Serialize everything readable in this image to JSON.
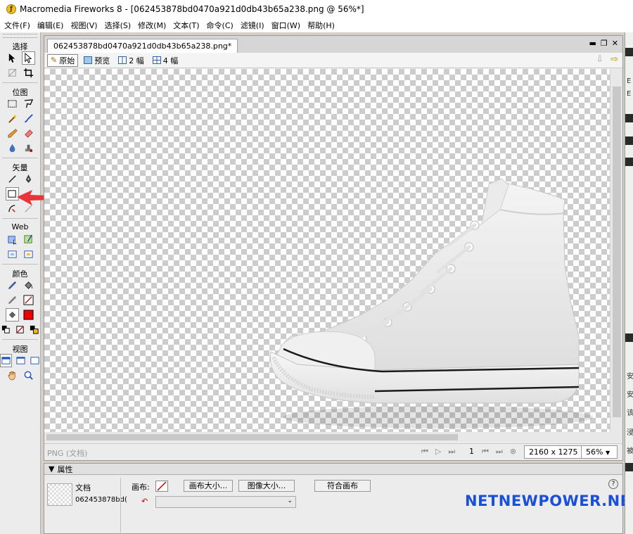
{
  "window": {
    "title": "Macromedia Fireworks 8 - [062453878bd0470a921d0db43b65a238.png @  56%*]",
    "app_icon_letter": "ƒ"
  },
  "menu": [
    "文件(F)",
    "编辑(E)",
    "视图(V)",
    "选择(S)",
    "修改(M)",
    "文本(T)",
    "命令(C)",
    "滤镜(I)",
    "窗口(W)",
    "帮助(H)"
  ],
  "tools": {
    "sections": {
      "select": "选择",
      "bitmap": "位图",
      "vector": "矢量",
      "web": "Web",
      "colors": "颜色",
      "view": "视图"
    },
    "stroke_color": "#cc0000",
    "fill_color": "#ee0000"
  },
  "document": {
    "tab_label": "062453878bd0470a921d0db43b65a238.png*",
    "view_buttons": [
      "原始",
      "预览",
      "2 幅",
      "4 幅"
    ],
    "active_view": "原始",
    "status_format": "PNG (文档)",
    "page_number": "1",
    "dimensions": "2160 x 1275",
    "zoom": "56%"
  },
  "properties": {
    "header": "属性",
    "object_type": "文档",
    "object_name": "062453878bd(",
    "canvas_label": "画布:",
    "buttons": [
      "画布大小...",
      "图像大小...",
      "符合画布"
    ],
    "help": "?"
  },
  "right_dock": {
    "labels": [
      "E",
      "E",
      "安",
      "安",
      "该",
      "浸",
      "被"
    ]
  },
  "watermark": "NETNEWPOWER.NET",
  "colors": {
    "annotation_arrow": "#e8343a",
    "watermark": "#1a4fd8"
  }
}
